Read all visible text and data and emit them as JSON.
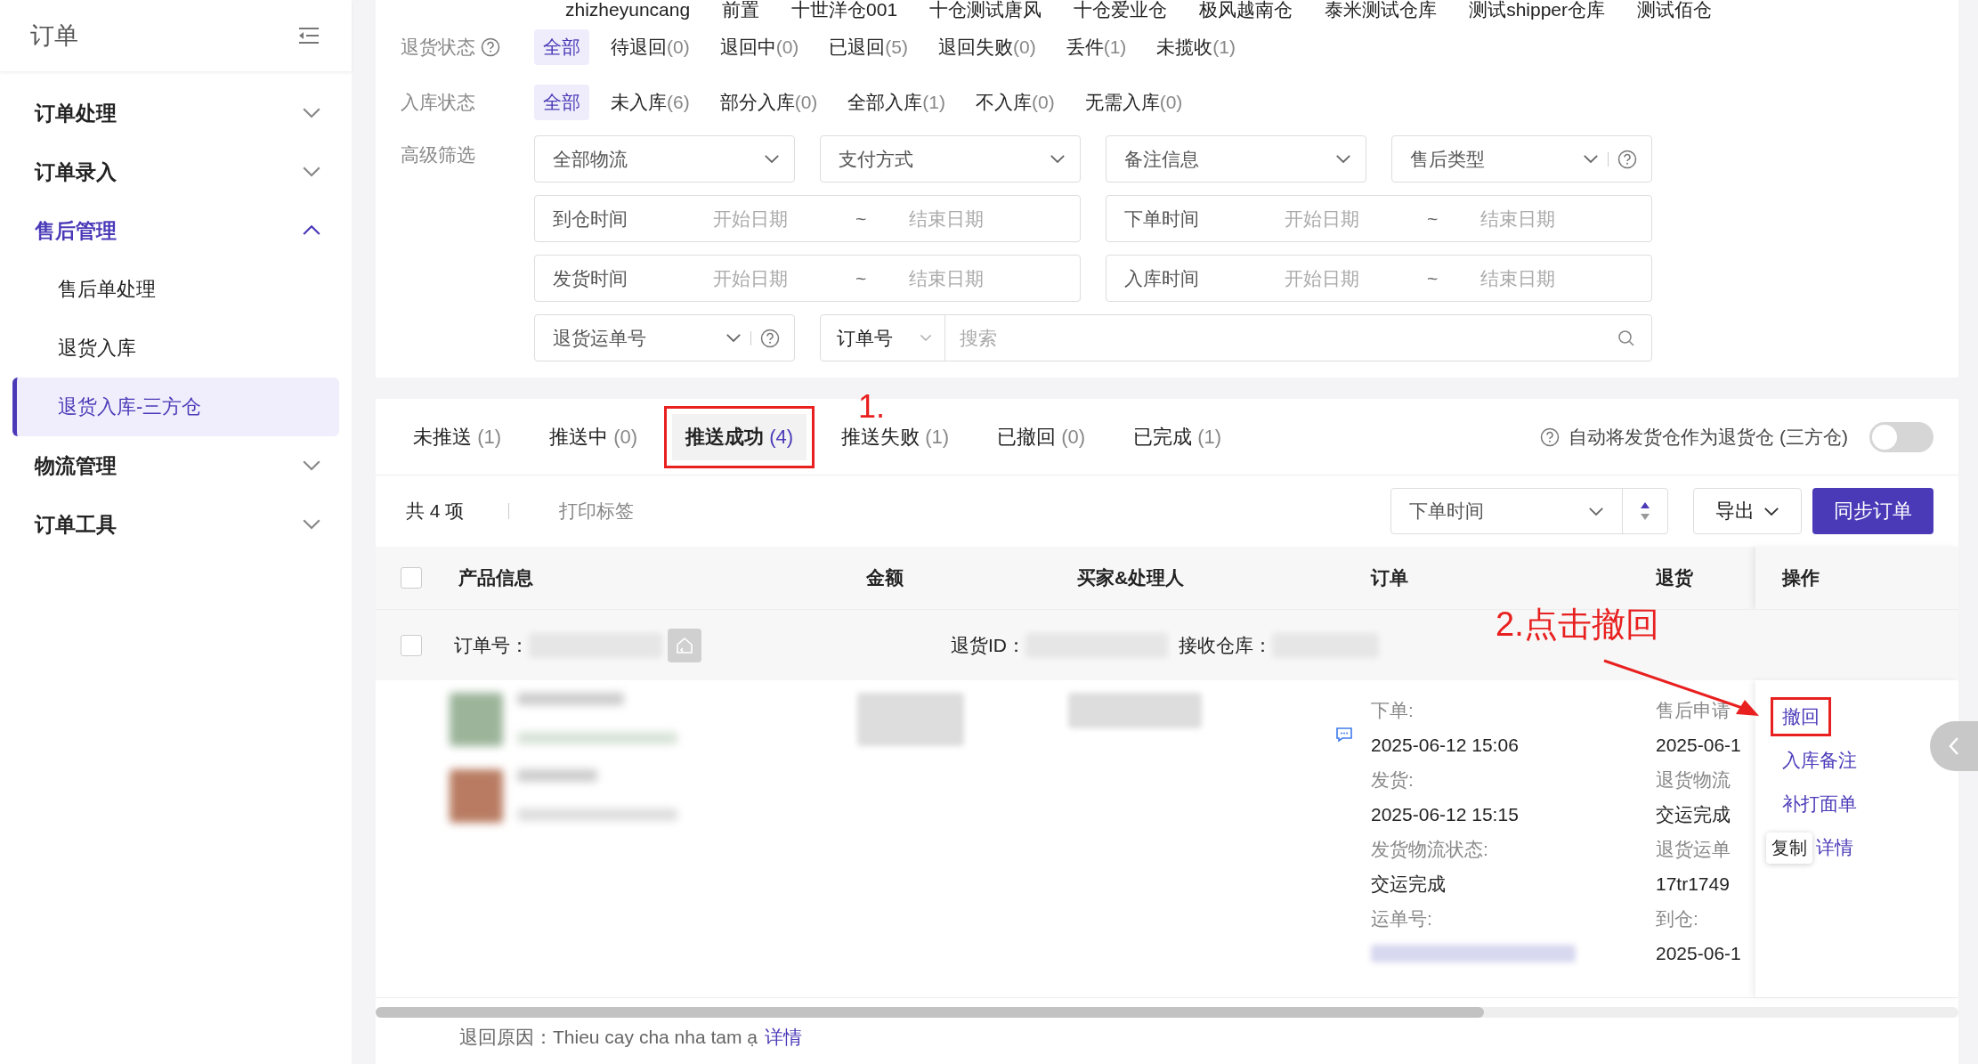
{
  "sidebar": {
    "title": "订单",
    "groups": [
      {
        "label": "订单处理",
        "expanded": false,
        "selected": false
      },
      {
        "label": "订单录入",
        "expanded": false,
        "selected": false
      },
      {
        "label": "售后管理",
        "expanded": true,
        "selected": true,
        "children": [
          {
            "label": "售后单处理",
            "selected": false
          },
          {
            "label": "退货入库",
            "selected": false
          },
          {
            "label": "退货入库-三方仓",
            "selected": true
          }
        ]
      },
      {
        "label": "物流管理",
        "expanded": false,
        "selected": false
      },
      {
        "label": "订单工具",
        "expanded": false,
        "selected": false
      }
    ]
  },
  "filters": {
    "warehouses": [
      "zhizheyuncang",
      "前置",
      "十世洋仓001",
      "十仓测试唐风",
      "十仓爱业仓",
      "极风越南仓",
      "泰米测试仓库",
      "测试shipper仓库",
      "测试佰仓"
    ],
    "status_rows": [
      {
        "label": "退货状态",
        "help": true,
        "options": [
          {
            "label": "全部",
            "selected": true
          },
          {
            "label": "待退回",
            "count": "(0)",
            "selected": false
          },
          {
            "label": "退回中",
            "count": "(0)",
            "selected": false
          },
          {
            "label": "已退回",
            "count": "(5)",
            "selected": false
          },
          {
            "label": "退回失败",
            "count": "(0)",
            "selected": false
          },
          {
            "label": "丢件",
            "count": "(1)",
            "selected": false
          },
          {
            "label": "未揽收",
            "count": "(1)",
            "selected": false
          }
        ]
      },
      {
        "label": "入库状态",
        "help": false,
        "options": [
          {
            "label": "全部",
            "selected": true
          },
          {
            "label": "未入库",
            "count": "(6)",
            "selected": false
          },
          {
            "label": "部分入库",
            "count": "(0)",
            "selected": false
          },
          {
            "label": "全部入库",
            "count": "(1)",
            "selected": false
          },
          {
            "label": "不入库",
            "count": "(0)",
            "selected": false
          },
          {
            "label": "无需入库",
            "count": "(0)",
            "selected": false
          }
        ]
      }
    ],
    "advanced": {
      "label": "高级筛选",
      "selects": [
        {
          "placeholder": "全部物流",
          "help": false
        },
        {
          "placeholder": "支付方式",
          "help": false
        },
        {
          "placeholder": "备注信息",
          "help": false
        },
        {
          "placeholder": "售后类型",
          "help": true
        }
      ],
      "date_ranges": [
        {
          "label": "到仓时间",
          "start": "开始日期",
          "separator": "~",
          "end": "结束日期"
        },
        {
          "label": "下单时间",
          "start": "开始日期",
          "separator": "~",
          "end": "结束日期"
        },
        {
          "label": "发货时间",
          "start": "开始日期",
          "separator": "~",
          "end": "结束日期"
        },
        {
          "label": "入库时间",
          "start": "开始日期",
          "separator": "~",
          "end": "结束日期"
        }
      ],
      "tracking_select": {
        "placeholder": "退货运单号",
        "help": true
      },
      "search": {
        "type_label": "订单号",
        "placeholder": "搜索"
      }
    }
  },
  "tabs": [
    {
      "label": "未推送",
      "count": "(1)",
      "selected": false,
      "highlighted": false
    },
    {
      "label": "推送中",
      "count": "(0)",
      "selected": false,
      "highlighted": false
    },
    {
      "label": "推送成功",
      "count": "(4)",
      "selected": true,
      "highlighted": true
    },
    {
      "label": "推送失败",
      "count": "(1)",
      "selected": false,
      "highlighted": false
    },
    {
      "label": "已撤回",
      "count": "(0)",
      "selected": false,
      "highlighted": false
    },
    {
      "label": "已完成",
      "count": "(1)",
      "selected": false,
      "highlighted": false
    }
  ],
  "auto_toggle": {
    "label": "自动将发货仓作为退货仓 (三方仓)",
    "on": false
  },
  "toolbar": {
    "total": "共 4 项",
    "print": "打印标签",
    "sort": "下单时间",
    "export": "导出",
    "sync": "同步订单"
  },
  "table": {
    "columns": [
      "产品信息",
      "金额",
      "买家&处理人",
      "订单",
      "退货",
      "操作"
    ],
    "select_all_checked": false,
    "row_checked": false,
    "group": {
      "order_label": "订单号：",
      "return_id_label": "退货ID：",
      "warehouse_label": "接收仓库："
    },
    "order_info": [
      {
        "label": "下单:",
        "value": "2025-06-12 15:06"
      },
      {
        "label": "发货:",
        "value": "2025-06-12 15:15"
      },
      {
        "label": "发货物流状态:",
        "value": "交运完成"
      },
      {
        "label": "运单号:"
      }
    ],
    "return_info": [
      "售后申请",
      "2025-06-1",
      "退货物流",
      "交运完成",
      "退货运单",
      "17tr1749",
      "到仓:",
      "2025-06-1"
    ],
    "actions": [
      {
        "label": "撤回",
        "highlighted": true
      },
      {
        "label": "入库备注",
        "highlighted": false
      },
      {
        "label": "补打面单",
        "highlighted": false
      },
      {
        "label": "详情",
        "highlighted": false
      }
    ],
    "tooltip": "复制",
    "reason": "退回原因：Thieu cay cha nha tam ạ",
    "reason_link": "详情"
  },
  "annotations": {
    "step_one": "1.",
    "step_two": "2.点击撤回"
  }
}
